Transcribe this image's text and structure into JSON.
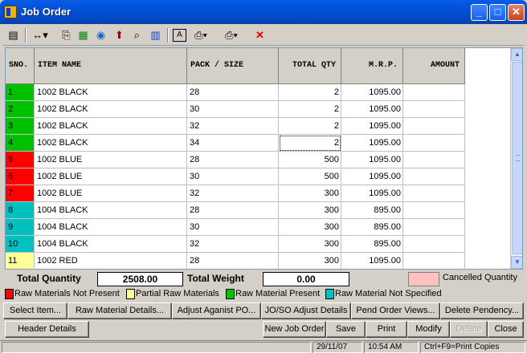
{
  "window": {
    "title": "Job Order"
  },
  "grid": {
    "columns": [
      {
        "label": "SNO.",
        "align": "left"
      },
      {
        "label": "ITEM NAME",
        "align": "left"
      },
      {
        "label": "PACK / SIZE",
        "align": "left"
      },
      {
        "label": "TOTAL QTY",
        "align": "right"
      },
      {
        "label": "M.R.P.",
        "align": "right"
      },
      {
        "label": "AMOUNT",
        "align": "right"
      }
    ],
    "rows": [
      {
        "sno": "1",
        "item": "1002 BLACK",
        "size": "28",
        "qty": "2",
        "mrp": "1095.00",
        "amount": "",
        "status": "green"
      },
      {
        "sno": "2",
        "item": "1002 BLACK",
        "size": "30",
        "qty": "2",
        "mrp": "1095.00",
        "amount": "",
        "status": "green"
      },
      {
        "sno": "3",
        "item": "1002 BLACK",
        "size": "32",
        "qty": "2",
        "mrp": "1095.00",
        "amount": "",
        "status": "green"
      },
      {
        "sno": "4",
        "item": "1002 BLACK",
        "size": "34",
        "qty": "2",
        "mrp": "1095.00",
        "amount": "",
        "status": "green"
      },
      {
        "sno": "5",
        "item": "1002 BLUE",
        "size": "28",
        "qty": "500",
        "mrp": "1095.00",
        "amount": "",
        "status": "red"
      },
      {
        "sno": "6",
        "item": "1002 BLUE",
        "size": "30",
        "qty": "500",
        "mrp": "1095.00",
        "amount": "",
        "status": "red"
      },
      {
        "sno": "7",
        "item": "1002 BLUE",
        "size": "32",
        "qty": "300",
        "mrp": "1095.00",
        "amount": "",
        "status": "red"
      },
      {
        "sno": "8",
        "item": "1004 BLACK",
        "size": "28",
        "qty": "300",
        "mrp": "895.00",
        "amount": "",
        "status": "cyan"
      },
      {
        "sno": "9",
        "item": "1004 BLACK",
        "size": "30",
        "qty": "300",
        "mrp": "895.00",
        "amount": "",
        "status": "cyan"
      },
      {
        "sno": "10",
        "item": "1004 BLACK",
        "size": "32",
        "qty": "300",
        "mrp": "895.00",
        "amount": "",
        "status": "cyan"
      },
      {
        "sno": "11",
        "item": "1002 RED",
        "size": "28",
        "qty": "300",
        "mrp": "1095.00",
        "amount": "",
        "status": "yellow"
      }
    ]
  },
  "status_colors": {
    "red": "#ff0000",
    "yellow": "#ffff99",
    "green": "#00c000",
    "cyan": "#00c0c0",
    "pink": "#ffc0c0"
  },
  "totals": {
    "qty_label": "Total Quantity",
    "qty_value": "2508.00",
    "weight_label": "Total Weight",
    "weight_value": "0.00",
    "cancelled_label": "Cancelled Quantity"
  },
  "legend": {
    "not_present": "Raw Materials Not Present",
    "partial": "Partial Raw Materials",
    "present": "Raw Material Present",
    "not_specified": "Raw Material Not Specified"
  },
  "buttons_row1": [
    "Select Item...",
    "Raw Material Details...",
    "Adjust Aganist PO...",
    "JO/SO Adjust Details",
    "Pend Order Views...",
    "Delete Pendency..."
  ],
  "buttons_row2": {
    "header": "Header Details",
    "new": "New Job Order",
    "save": "Save",
    "print": "Print",
    "modify": "Modify",
    "delete": "Delete",
    "close": "Close"
  },
  "statusbar": {
    "date": "29/11/07",
    "time": "10:54 AM",
    "hint": "Ctrl+F9=Print Copies"
  }
}
